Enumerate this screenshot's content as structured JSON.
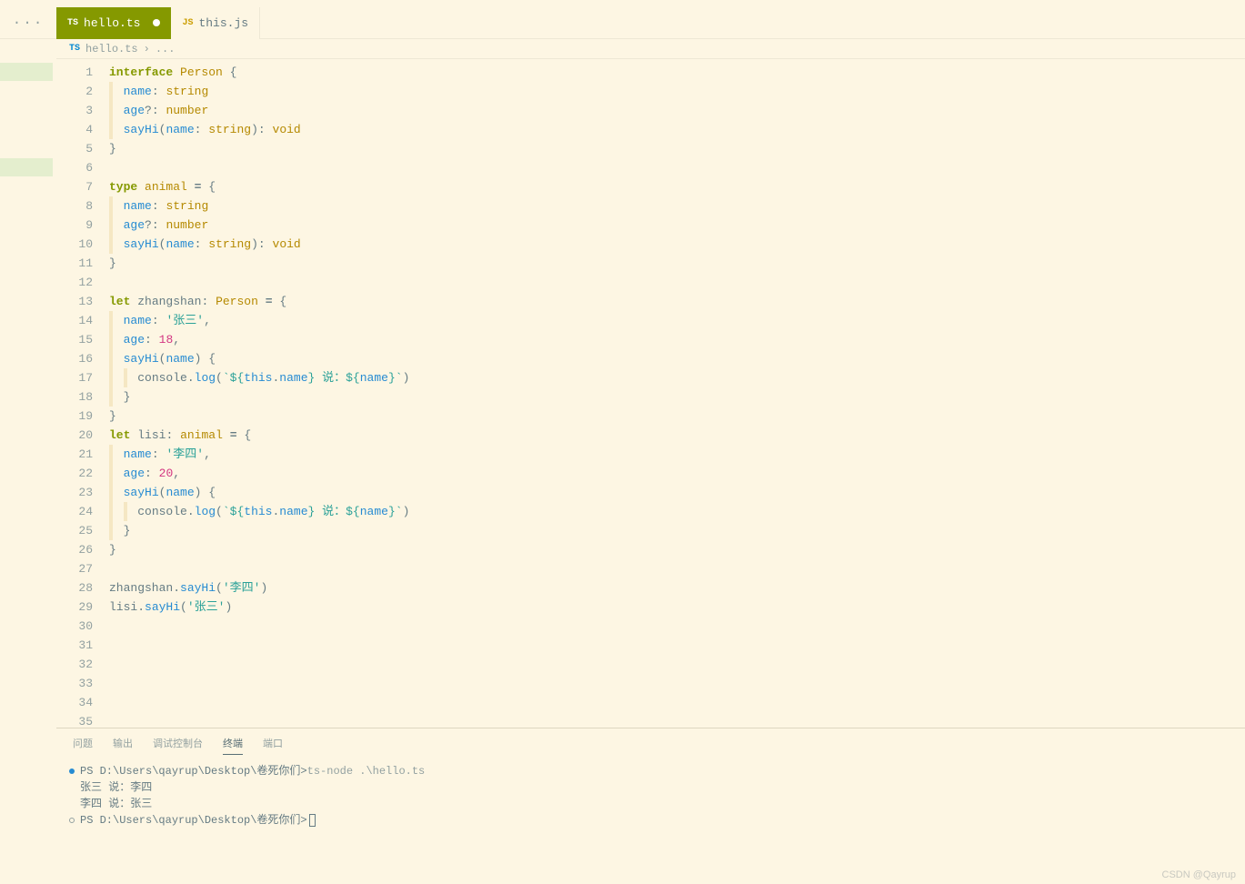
{
  "tabs": [
    {
      "icon": "TS",
      "label": "hello.ts",
      "active": true,
      "dirty": true
    },
    {
      "icon": "JS",
      "label": "this.js",
      "active": false,
      "dirty": false
    }
  ],
  "breadcrumbs": {
    "icon": "TS",
    "file": "hello.ts",
    "sep": "›",
    "more": "..."
  },
  "code": {
    "lines": [
      {
        "n": 1,
        "html": "<span class='kw'>interface</span> <span class='type'>Person</span> <span class='punct'>{</span>"
      },
      {
        "n": 2,
        "indent": 1,
        "html": "  <span class='prop'>name</span><span class='punct'>:</span> <span class='type'>string</span>"
      },
      {
        "n": 3,
        "indent": 1,
        "html": "  <span class='prop'>age</span><span class='punct'>?:</span> <span class='type'>number</span>"
      },
      {
        "n": 4,
        "indent": 1,
        "html": "  <span class='func'>sayHi</span><span class='punct'>(</span><span class='prop'>name</span><span class='punct'>:</span> <span class='type'>string</span><span class='punct'>):</span> <span class='type'>void</span>"
      },
      {
        "n": 5,
        "html": "<span class='punct'>}</span>"
      },
      {
        "n": 6,
        "html": ""
      },
      {
        "n": 7,
        "html": "<span class='kw'>type</span> <span class='type'>animal</span> <span class='op'>=</span> <span class='punct'>{</span>"
      },
      {
        "n": 8,
        "indent": 1,
        "html": "  <span class='prop'>name</span><span class='punct'>:</span> <span class='type'>string</span>"
      },
      {
        "n": 9,
        "indent": 1,
        "html": "  <span class='prop'>age</span><span class='punct'>?:</span> <span class='type'>number</span>"
      },
      {
        "n": 10,
        "indent": 1,
        "html": "  <span class='func'>sayHi</span><span class='punct'>(</span><span class='prop'>name</span><span class='punct'>:</span> <span class='type'>string</span><span class='punct'>):</span> <span class='type'>void</span>"
      },
      {
        "n": 11,
        "html": "<span class='punct'>}</span>"
      },
      {
        "n": 12,
        "html": ""
      },
      {
        "n": 13,
        "html": "<span class='kw'>let</span> <span class='plain'>zhangshan</span><span class='punct'>:</span> <span class='type'>Person</span> <span class='op'>=</span> <span class='punct'>{</span>"
      },
      {
        "n": 14,
        "indent": 1,
        "html": "  <span class='prop'>name</span><span class='punct'>:</span> <span class='str'>'张三'</span><span class='punct'>,</span>"
      },
      {
        "n": 15,
        "indent": 1,
        "html": "  <span class='prop'>age</span><span class='punct'>:</span> <span class='num'>18</span><span class='punct'>,</span>"
      },
      {
        "n": 16,
        "indent": 1,
        "html": "  <span class='func'>sayHi</span><span class='punct'>(</span><span class='prop'>name</span><span class='punct'>)</span> <span class='punct'>{</span>"
      },
      {
        "n": 17,
        "indent": 2,
        "html": "    <span class='plain'>console</span><span class='punct'>.</span><span class='func'>log</span><span class='punct'>(</span><span class='str'>`${</span><span class='this'>this</span><span class='punct'>.</span><span class='prop'>name</span><span class='str'>} 说：${</span><span class='prop'>name</span><span class='str'>}`</span><span class='punct'>)</span>"
      },
      {
        "n": 18,
        "indent": 1,
        "html": "  <span class='punct'>}</span>"
      },
      {
        "n": 19,
        "html": "<span class='punct'>}</span>"
      },
      {
        "n": 20,
        "html": "<span class='kw'>let</span> <span class='plain'>lisi</span><span class='punct'>:</span> <span class='type'>animal</span> <span class='op'>=</span> <span class='punct'>{</span>"
      },
      {
        "n": 21,
        "indent": 1,
        "html": "  <span class='prop'>name</span><span class='punct'>:</span> <span class='str'>'李四'</span><span class='punct'>,</span>"
      },
      {
        "n": 22,
        "indent": 1,
        "html": "  <span class='prop'>age</span><span class='punct'>:</span> <span class='num'>20</span><span class='punct'>,</span>"
      },
      {
        "n": 23,
        "indent": 1,
        "html": "  <span class='func'>sayHi</span><span class='punct'>(</span><span class='prop'>name</span><span class='punct'>)</span> <span class='punct'>{</span>"
      },
      {
        "n": 24,
        "indent": 2,
        "html": "    <span class='plain'>console</span><span class='punct'>.</span><span class='func'>log</span><span class='punct'>(</span><span class='str'>`${</span><span class='this'>this</span><span class='punct'>.</span><span class='prop'>name</span><span class='str'>} 说：${</span><span class='prop'>name</span><span class='str'>}`</span><span class='punct'>)</span>"
      },
      {
        "n": 25,
        "indent": 1,
        "html": "  <span class='punct'>}</span>"
      },
      {
        "n": 26,
        "html": "<span class='punct'>}</span>"
      },
      {
        "n": 27,
        "html": ""
      },
      {
        "n": 28,
        "html": "<span class='plain'>zhangshan</span><span class='punct'>.</span><span class='func'>sayHi</span><span class='punct'>(</span><span class='str'>'李四'</span><span class='punct'>)</span>"
      },
      {
        "n": 29,
        "html": "<span class='plain'>lisi</span><span class='punct'>.</span><span class='func'>sayHi</span><span class='punct'>(</span><span class='str'>'张三'</span><span class='punct'>)</span>"
      },
      {
        "n": 30,
        "html": ""
      },
      {
        "n": 31,
        "html": ""
      },
      {
        "n": 32,
        "html": ""
      },
      {
        "n": 33,
        "html": ""
      },
      {
        "n": 34,
        "html": ""
      },
      {
        "n": 35,
        "html": ""
      }
    ],
    "gutter_highlights": [
      1,
      6
    ]
  },
  "terminal": {
    "tabs": [
      {
        "label": "问题",
        "active": false
      },
      {
        "label": "输出",
        "active": false
      },
      {
        "label": "调试控制台",
        "active": false
      },
      {
        "label": "终端",
        "active": true
      },
      {
        "label": "端口",
        "active": false
      }
    ],
    "lines": [
      {
        "bullet": "blue",
        "path": "PS D:\\Users\\qayrup\\Desktop\\卷死你们> ",
        "cmd": "ts-node .\\hello.ts"
      },
      {
        "text": "张三 说：李四"
      },
      {
        "text": "李四 说：张三"
      },
      {
        "bullet": "gray",
        "path": "PS D:\\Users\\qayrup\\Desktop\\卷死你们> ",
        "cursor": true
      }
    ]
  },
  "watermark": "CSDN @Qayrup"
}
